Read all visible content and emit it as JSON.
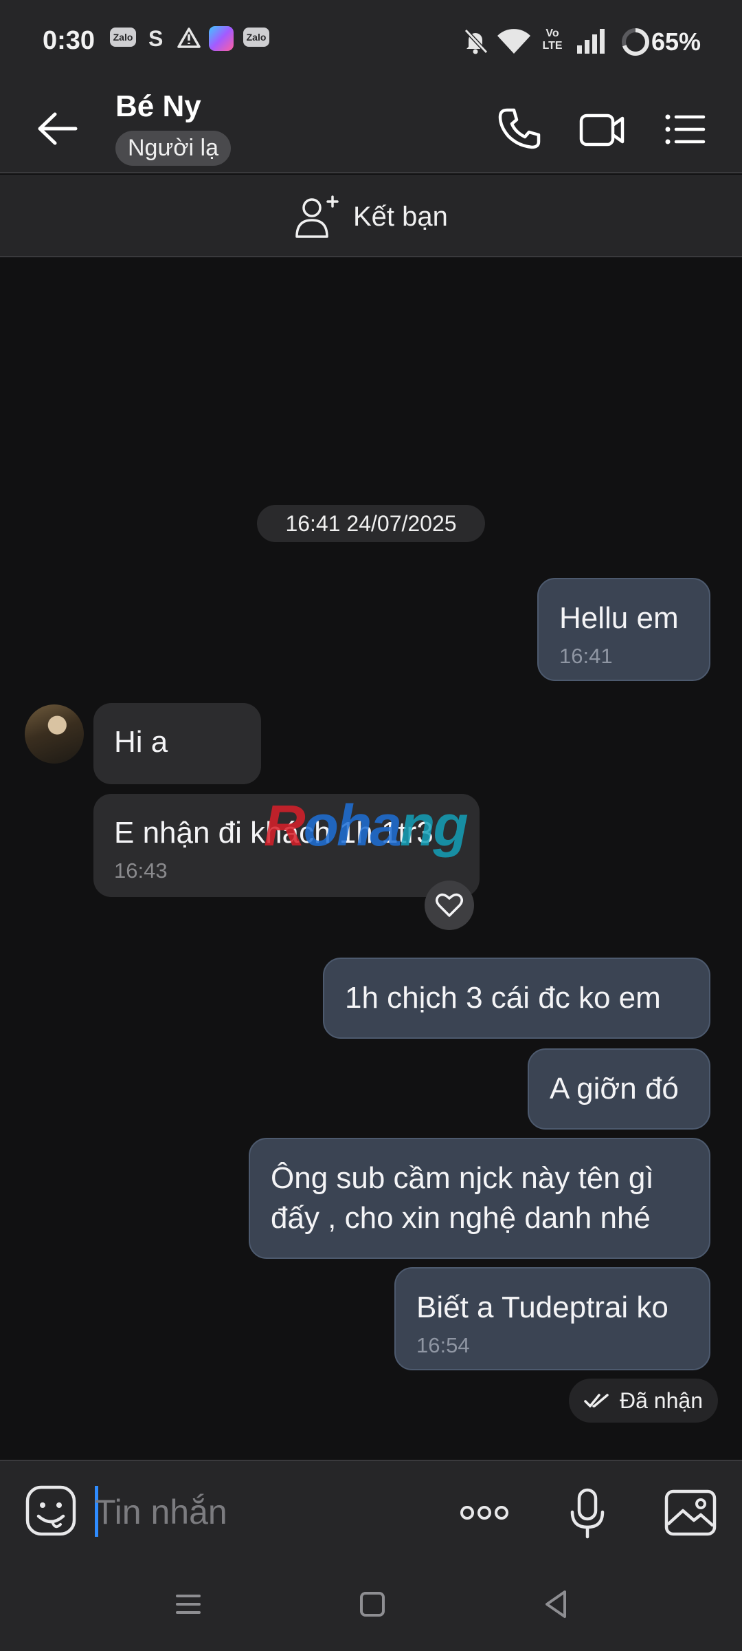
{
  "status_bar": {
    "time": "0:30",
    "notification_icons": [
      "zalo-icon",
      "s-icon",
      "warning-icon",
      "app-icon",
      "zalo-icon"
    ],
    "zalo_label": "Zalo",
    "s_label": "S",
    "volte_label": "Vo LTE",
    "battery": "65%"
  },
  "header": {
    "contact_name": "Bé Ny",
    "contact_tag": "Người lạ"
  },
  "friend_bar": {
    "label": "Kết bạn"
  },
  "chat": {
    "date": "16:41 24/07/2025",
    "messages": [
      {
        "from": "me",
        "text": "Hellu em",
        "time": "16:41"
      },
      {
        "from": "them",
        "text": "Hi a",
        "time": ""
      },
      {
        "from": "them",
        "text": "E nhận đi khách 1h 1tr3",
        "time": "16:43"
      },
      {
        "from": "me",
        "text": "1h chịch 3 cái đc ko em",
        "time": ""
      },
      {
        "from": "me",
        "text": "A giỡn đó",
        "time": ""
      },
      {
        "from": "me",
        "text": "Ông sub cầm njck này tên gì đấy , cho xin nghệ danh nhé",
        "time": ""
      },
      {
        "from": "me",
        "text": "Biết a Tudeptrai ko",
        "time": "16:54"
      }
    ],
    "watermark": [
      "R",
      "oha",
      "ng"
    ],
    "seen_label": "Đã nhận"
  },
  "input_bar": {
    "placeholder": "Tin nhắn"
  },
  "colors": {
    "background": "#111112",
    "bar": "#262628",
    "my_bubble": "#3b4453",
    "their_bubble": "#2c2c2e",
    "cursor": "#2f8cff"
  }
}
